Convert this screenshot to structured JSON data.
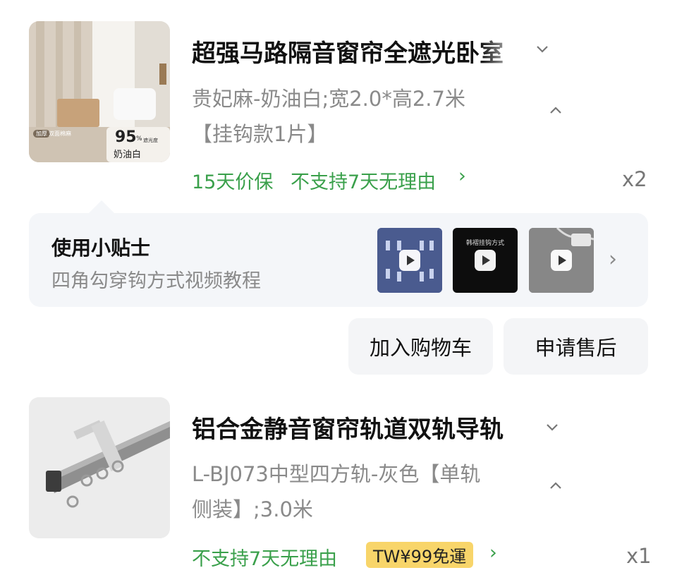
{
  "orders": [
    {
      "thumb_badge": "95",
      "thumb_badge_unit": "%",
      "thumb_badge_note": "遮光度",
      "thumb_caption": "奶油白",
      "thumb_tag": "双面棉麻",
      "thumb_tag_pill": "加厚",
      "title": "超强马路隔音窗帘全遮光卧室",
      "spec_line1": "贵妃麻-奶油白;宽2.0*高2.7米",
      "spec_line2": "【挂钩款1片】",
      "price_protect": "15天价保",
      "no_return": "不支持7天无理由",
      "arrow": "›",
      "quantity": "x2"
    },
    {
      "title": "铝合金静音窗帘轨道双轨导轨",
      "spec_line1": "L-BJ073中型四方轨-灰色【单轨",
      "spec_line2": "侧装】;3.0米",
      "no_return": "不支持7天无理由",
      "shipping_badge": "TW¥99免運",
      "arrow": "›",
      "quantity": "x1"
    }
  ],
  "tips": {
    "title": "使用小贴士",
    "subtitle": "四角勾穿钩方式视频教程",
    "videos": [
      {
        "caption": "",
        "bg": "#4a5b8f"
      },
      {
        "caption": "韩褶挂钩方式",
        "bg": "#0d0d0d"
      },
      {
        "caption": "",
        "bg": "#8c8c8c"
      }
    ],
    "more": "›"
  },
  "actions": {
    "add_to_cart": "加入购物车",
    "after_sales": "申请售后"
  },
  "icons": {
    "chevron_down": "chevron-down-icon",
    "chevron_up": "chevron-up-icon",
    "chevron_right": "chevron-right-icon",
    "play": "play-icon"
  },
  "colors": {
    "green": "#3aa04b",
    "badge_yellow": "#f8d56a",
    "card_bg": "#f4f6f9"
  }
}
